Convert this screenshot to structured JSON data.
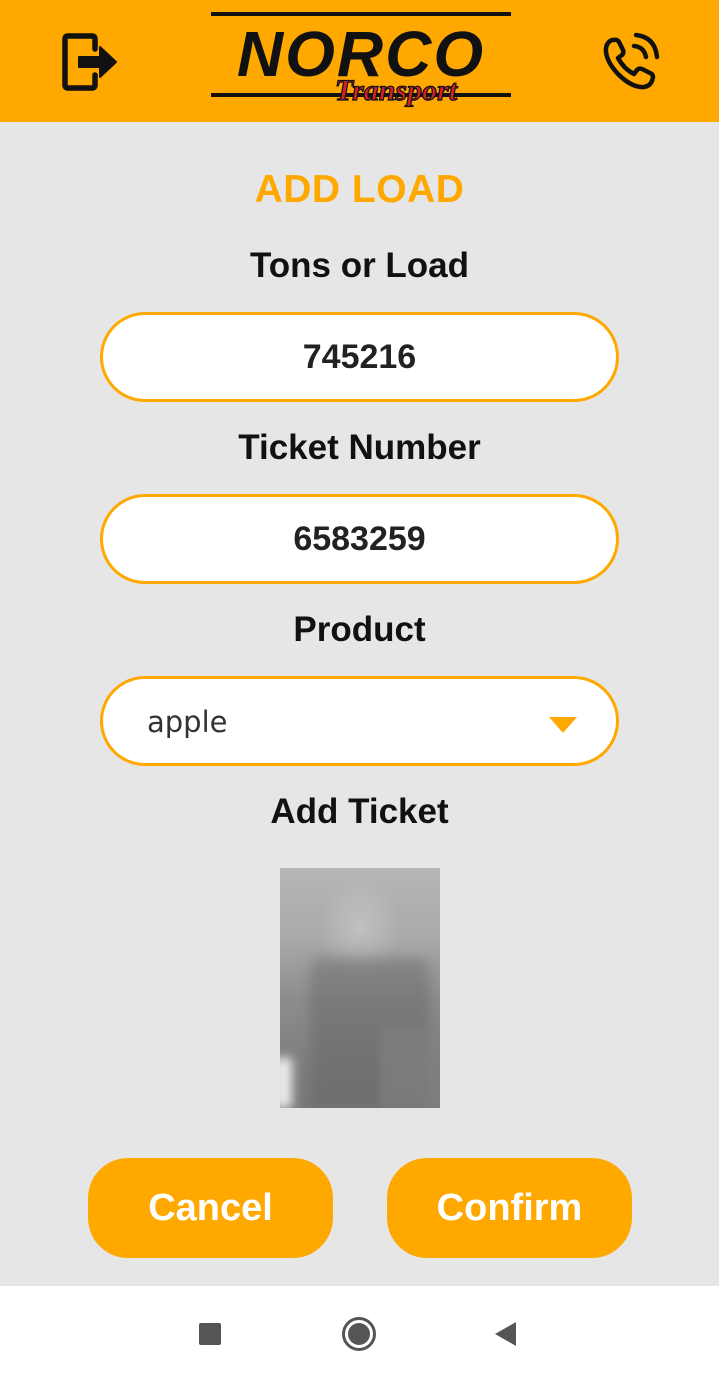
{
  "header": {
    "logo_main": "NORCO",
    "logo_sub": "Transport",
    "logout_icon": "logout-icon",
    "phone_icon": "phone-icon",
    "background": "#ffa800"
  },
  "form": {
    "title": "ADD LOAD",
    "tons_label": "Tons or Load",
    "tons_value": "745216",
    "ticket_label": "Ticket Number",
    "ticket_value": "6583259",
    "product_label": "Product",
    "product_selected": "apple",
    "add_ticket_label": "Add Ticket"
  },
  "actions": {
    "cancel": "Cancel",
    "confirm": "Confirm"
  },
  "navbar": {
    "recent_icon": "square-icon",
    "home_icon": "circle-icon",
    "back_icon": "triangle-back-icon"
  },
  "colors": {
    "accent": "#ffa800",
    "page_bg": "#e6e6e6",
    "text": "#111111"
  }
}
